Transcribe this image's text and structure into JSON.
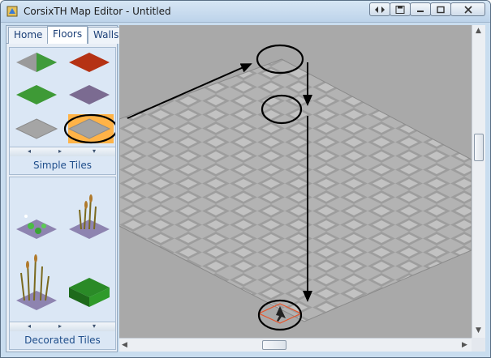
{
  "window": {
    "title": "CorsixTH Map Editor - Untitled",
    "buttons": [
      "navigate-icon",
      "save-icon",
      "minimize-icon",
      "maximize-icon",
      "close-icon"
    ]
  },
  "tabs": [
    {
      "label": "Home",
      "active": false
    },
    {
      "label": "Floors",
      "active": true
    },
    {
      "label": "Walls",
      "active": false
    }
  ],
  "palettes": {
    "simple": {
      "label": "Simple Tiles"
    },
    "decorated": {
      "label": "Decorated Tiles"
    }
  },
  "colors": {
    "map_background": "#a9a9a9",
    "highlight_tile": "#ffb347",
    "selection_outline": "#e8542a",
    "panel_label": "#1f4e8b"
  }
}
